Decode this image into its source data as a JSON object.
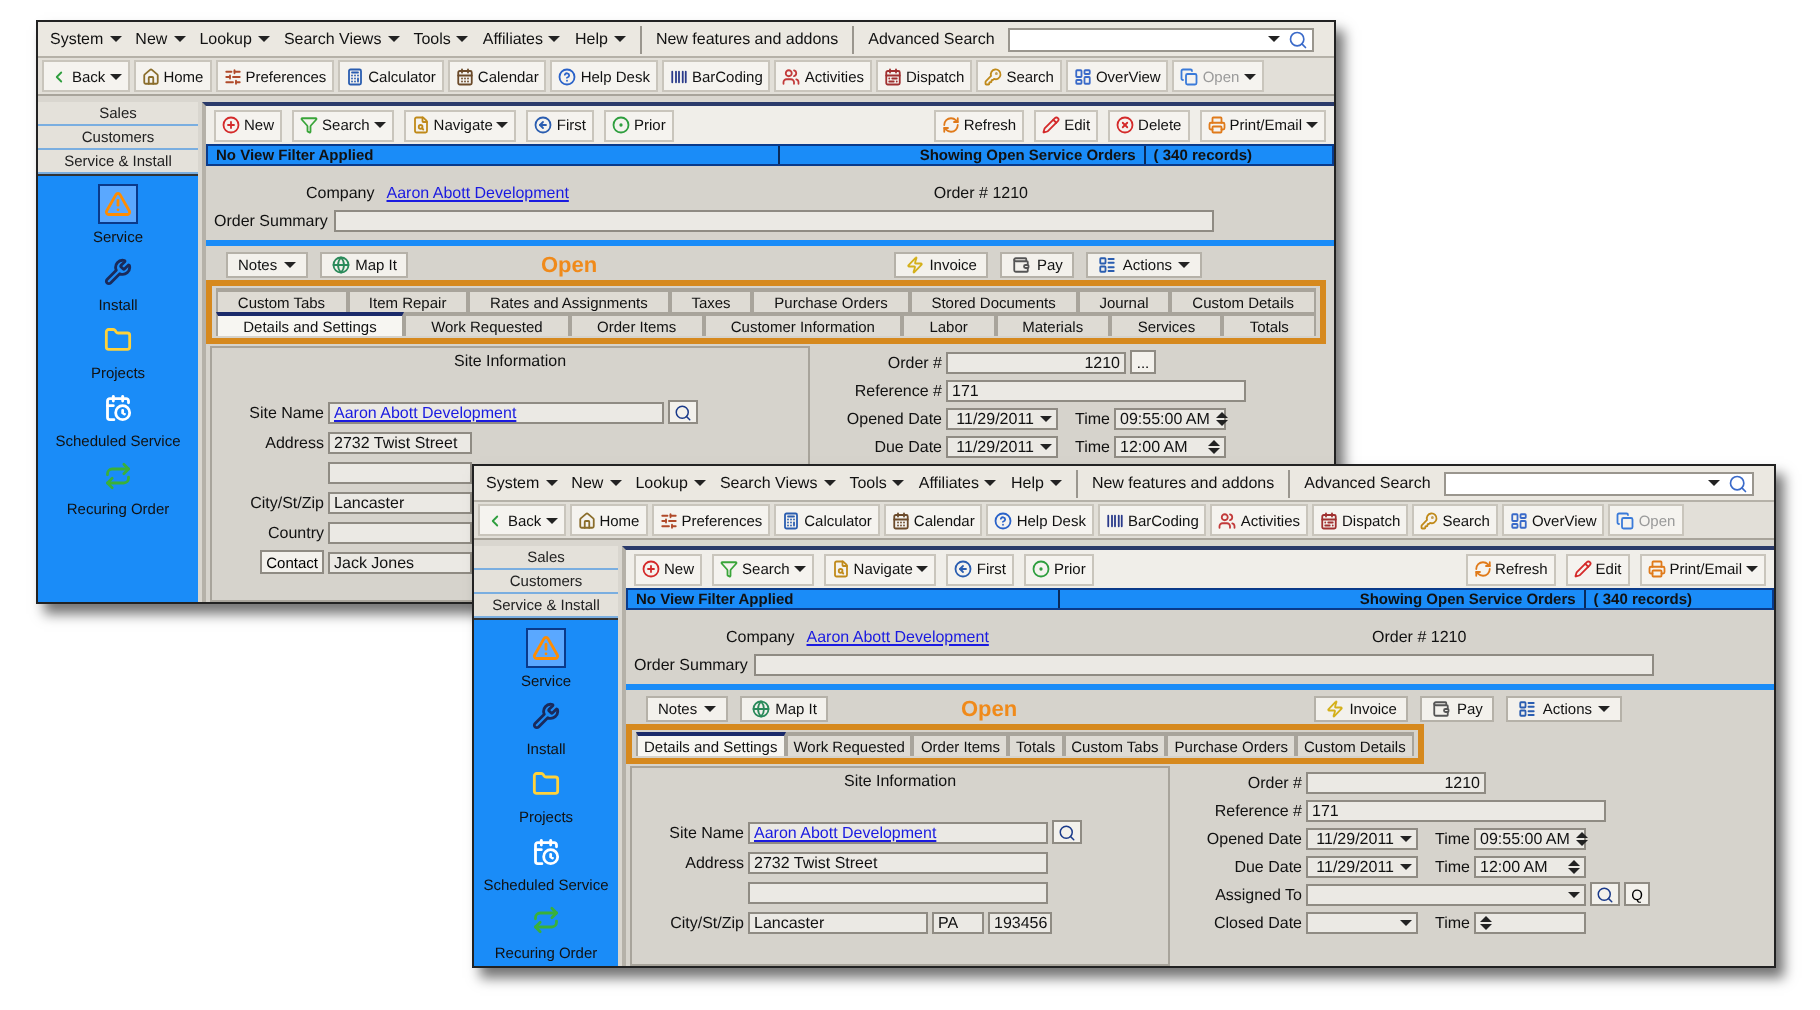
{
  "windows": [
    {
      "menus": [
        "System",
        "New",
        "Lookup",
        "Search Views",
        "Tools",
        "Affiliates",
        "Help"
      ],
      "whats_new": "New features and addons",
      "advanced_search": {
        "label": "Advanced Search"
      },
      "toolbar": [
        {
          "label": "Back",
          "kind": "back",
          "dropdown": true,
          "disabled": false
        },
        {
          "label": "Home",
          "kind": "home",
          "dropdown": false,
          "disabled": false
        },
        {
          "label": "Preferences",
          "kind": "preferences",
          "dropdown": false,
          "disabled": false
        },
        {
          "label": "Calculator",
          "kind": "calculator",
          "dropdown": false,
          "disabled": false
        },
        {
          "label": "Calendar",
          "kind": "calendar",
          "dropdown": false,
          "disabled": false
        },
        {
          "label": "Help Desk",
          "kind": "help",
          "dropdown": false,
          "disabled": false
        },
        {
          "label": "BarCoding",
          "kind": "barcode",
          "dropdown": false,
          "disabled": false
        },
        {
          "label": "Activities",
          "kind": "activities",
          "dropdown": false,
          "disabled": false
        },
        {
          "label": "Dispatch",
          "kind": "dispatch",
          "dropdown": false,
          "disabled": false
        },
        {
          "label": "Search",
          "kind": "key",
          "dropdown": false,
          "disabled": false
        },
        {
          "label": "OverView",
          "kind": "overview",
          "dropdown": false,
          "disabled": false
        },
        {
          "label": "Open",
          "kind": "open",
          "dropdown": true,
          "disabled": true
        }
      ],
      "sidebar": {
        "sections": [
          "Sales",
          "Customers",
          "Service & Install"
        ],
        "items": [
          {
            "label": "Service",
            "kind": "service",
            "selected": true
          },
          {
            "label": "Install",
            "kind": "install",
            "selected": false
          },
          {
            "label": "Projects",
            "kind": "projects",
            "selected": false
          },
          {
            "label": "Scheduled Service",
            "kind": "scheduled",
            "selected": false
          },
          {
            "label": "Recuring Order",
            "kind": "recurring",
            "selected": false
          }
        ]
      },
      "actions_left": [
        {
          "label": "New",
          "kind": "new",
          "dropdown": false
        },
        {
          "label": "Search",
          "kind": "filter",
          "dropdown": true
        },
        {
          "label": "Navigate",
          "kind": "navigate",
          "dropdown": true
        },
        {
          "label": "First",
          "kind": "first",
          "dropdown": false
        },
        {
          "label": "Prior",
          "kind": "prior",
          "dropdown": false
        }
      ],
      "actions_right": [
        {
          "label": "Refresh",
          "kind": "refresh",
          "dropdown": false
        },
        {
          "label": "Edit",
          "kind": "edit",
          "dropdown": false
        },
        {
          "label": "Delete",
          "kind": "delete",
          "dropdown": false
        },
        {
          "label": "Print/Email",
          "kind": "print",
          "dropdown": true
        }
      ],
      "filter_bar": {
        "filter": "No View Filter Applied",
        "status": "Showing Open Service Orders",
        "count": "( 340 records)"
      },
      "company": {
        "label": "Company",
        "value": "Aaron Abott Development"
      },
      "order": {
        "label": "Order #",
        "value": "1210"
      },
      "order_summary": {
        "label": "Order Summary"
      },
      "buttons_left": [
        {
          "label": "Notes",
          "kind": "plain",
          "dropdown": true
        },
        {
          "label": "Map It",
          "kind": "globe",
          "dropdown": false
        }
      ],
      "status": "Open",
      "buttons_right": [
        {
          "label": "Invoice",
          "kind": "invoice",
          "dropdown": false
        },
        {
          "label": "Pay",
          "kind": "pay",
          "dropdown": false
        },
        {
          "label": "Actions",
          "kind": "actions",
          "dropdown": true
        }
      ],
      "tab_rows": [
        [
          {
            "label": "Custom Tabs",
            "selected": false
          },
          {
            "label": "Item Repair",
            "selected": false
          },
          {
            "label": "Rates and Assignments",
            "selected": false
          },
          {
            "label": "Taxes",
            "selected": false
          },
          {
            "label": "Purchase Orders",
            "selected": false
          },
          {
            "label": "Stored Documents",
            "selected": false
          },
          {
            "label": "Journal",
            "selected": false
          },
          {
            "label": "Custom Details",
            "selected": false
          }
        ],
        [
          {
            "label": "Details and Settings",
            "selected": true
          },
          {
            "label": "Work Requested",
            "selected": false
          },
          {
            "label": "Order Items",
            "selected": false
          },
          {
            "label": "Customer Information",
            "selected": false
          },
          {
            "label": "Labor",
            "selected": false
          },
          {
            "label": "Materials",
            "selected": false
          },
          {
            "label": "Services",
            "selected": false
          },
          {
            "label": "Totals",
            "selected": false
          }
        ]
      ],
      "site_info": {
        "title": "Site Information",
        "fields": [
          {
            "label": "Site Name",
            "value": "Aaron Abott Development",
            "kind": "link"
          },
          {
            "label": "Address",
            "value": "2732 Twist Street",
            "kind": "text"
          },
          {
            "kind": "text"
          },
          {
            "label": "City/St/Zip",
            "value": "Lancaster",
            "kind": "city"
          },
          {
            "label": "Country",
            "kind": "text"
          },
          {
            "label": "Contact",
            "value": "Jack Jones",
            "kind": "button"
          }
        ]
      },
      "order_info": [
        {
          "label": "Order #",
          "value": "1210",
          "kind": "number",
          "more": "..."
        },
        {
          "label": "Reference #",
          "value": "171",
          "kind": "text"
        },
        {
          "label": "Opened Date",
          "value": "11/29/2011",
          "kind": "date",
          "time_label": "Time",
          "time": "09:55:00 AM"
        },
        {
          "label": "Due Date",
          "value": "11/29/2011",
          "kind": "date",
          "time_label": "Time",
          "time": "12:00 AM"
        }
      ]
    },
    {
      "menus": [
        "System",
        "New",
        "Lookup",
        "Search Views",
        "Tools",
        "Affiliates",
        "Help"
      ],
      "whats_new": "New features and addons",
      "advanced_search": {
        "label": "Advanced Search"
      },
      "toolbar": [
        {
          "label": "Back",
          "kind": "back",
          "dropdown": true,
          "disabled": false
        },
        {
          "label": "Home",
          "kind": "home",
          "dropdown": false,
          "disabled": false
        },
        {
          "label": "Preferences",
          "kind": "preferences",
          "dropdown": false,
          "disabled": false
        },
        {
          "label": "Calculator",
          "kind": "calculator",
          "dropdown": false,
          "disabled": false
        },
        {
          "label": "Calendar",
          "kind": "calendar",
          "dropdown": false,
          "disabled": false
        },
        {
          "label": "Help Desk",
          "kind": "help",
          "dropdown": false,
          "disabled": false
        },
        {
          "label": "BarCoding",
          "kind": "barcode",
          "dropdown": false,
          "disabled": false
        },
        {
          "label": "Activities",
          "kind": "activities",
          "dropdown": false,
          "disabled": false
        },
        {
          "label": "Dispatch",
          "kind": "dispatch",
          "dropdown": false,
          "disabled": false
        },
        {
          "label": "Search",
          "kind": "key",
          "dropdown": false,
          "disabled": false
        },
        {
          "label": "OverView",
          "kind": "overview",
          "dropdown": false,
          "disabled": false
        },
        {
          "label": "Open",
          "kind": "open",
          "dropdown": false,
          "disabled": true
        }
      ],
      "sidebar": {
        "sections": [
          "Sales",
          "Customers",
          "Service & Install"
        ],
        "items": [
          {
            "label": "Service",
            "kind": "service",
            "selected": true
          },
          {
            "label": "Install",
            "kind": "install",
            "selected": false
          },
          {
            "label": "Projects",
            "kind": "projects",
            "selected": false
          },
          {
            "label": "Scheduled Service",
            "kind": "scheduled",
            "selected": false
          },
          {
            "label": "Recuring Order",
            "kind": "recurring",
            "selected": false
          }
        ]
      },
      "actions_left": [
        {
          "label": "New",
          "kind": "new",
          "dropdown": false
        },
        {
          "label": "Search",
          "kind": "filter",
          "dropdown": true
        },
        {
          "label": "Navigate",
          "kind": "navigate",
          "dropdown": true
        },
        {
          "label": "First",
          "kind": "first",
          "dropdown": false
        },
        {
          "label": "Prior",
          "kind": "prior",
          "dropdown": false
        }
      ],
      "actions_right": [
        {
          "label": "Refresh",
          "kind": "refresh",
          "dropdown": false
        },
        {
          "label": "Edit",
          "kind": "edit",
          "dropdown": false
        },
        {
          "label": "Print/Email",
          "kind": "print",
          "dropdown": true
        }
      ],
      "filter_bar": {
        "filter": "No View Filter Applied",
        "status": "Showing Open Service Orders",
        "count": "( 340 records)"
      },
      "company": {
        "label": "Company",
        "value": "Aaron Abott Development"
      },
      "order": {
        "label": "Order #",
        "value": "1210"
      },
      "order_summary": {
        "label": "Order Summary"
      },
      "buttons_left": [
        {
          "label": "Notes",
          "kind": "plain",
          "dropdown": true
        },
        {
          "label": "Map It",
          "kind": "globe",
          "dropdown": false
        }
      ],
      "status": "Open",
      "buttons_right": [
        {
          "label": "Invoice",
          "kind": "invoice",
          "dropdown": false
        },
        {
          "label": "Pay",
          "kind": "pay",
          "dropdown": false
        },
        {
          "label": "Actions",
          "kind": "actions",
          "dropdown": true
        }
      ],
      "tab_rows": [
        [
          {
            "label": "Details and Settings",
            "selected": true
          },
          {
            "label": "Work Requested",
            "selected": false
          },
          {
            "label": "Order Items",
            "selected": false
          },
          {
            "label": "Totals",
            "selected": false
          },
          {
            "label": "Custom Tabs",
            "selected": false
          },
          {
            "label": "Purchase Orders",
            "selected": false
          },
          {
            "label": "Custom Details",
            "selected": false
          }
        ]
      ],
      "site_info": {
        "title": "Site Information",
        "fields": [
          {
            "label": "Site Name",
            "value": "Aaron Abott Development",
            "kind": "link"
          },
          {
            "label": "Address",
            "value": "2732 Twist Street",
            "kind": "text"
          },
          {
            "kind": "text"
          },
          {
            "label": "City/St/Zip",
            "value": "Lancaster",
            "state": "PA",
            "zip": "193456",
            "kind": "city"
          }
        ]
      },
      "order_info": [
        {
          "label": "Order #",
          "value": "1210",
          "kind": "number"
        },
        {
          "label": "Reference #",
          "value": "171",
          "kind": "text"
        },
        {
          "label": "Opened Date",
          "value": "11/29/2011",
          "kind": "date",
          "time_label": "Time",
          "time": "09:55:00 AM"
        },
        {
          "label": "Due Date",
          "value": "11/29/2011",
          "kind": "date",
          "time_label": "Time",
          "time": "12:00 AM"
        },
        {
          "label": "Assigned To",
          "kind": "lookup",
          "q": "Q"
        },
        {
          "label": "Closed Date",
          "kind": "date",
          "time_label": "Time"
        }
      ]
    }
  ]
}
